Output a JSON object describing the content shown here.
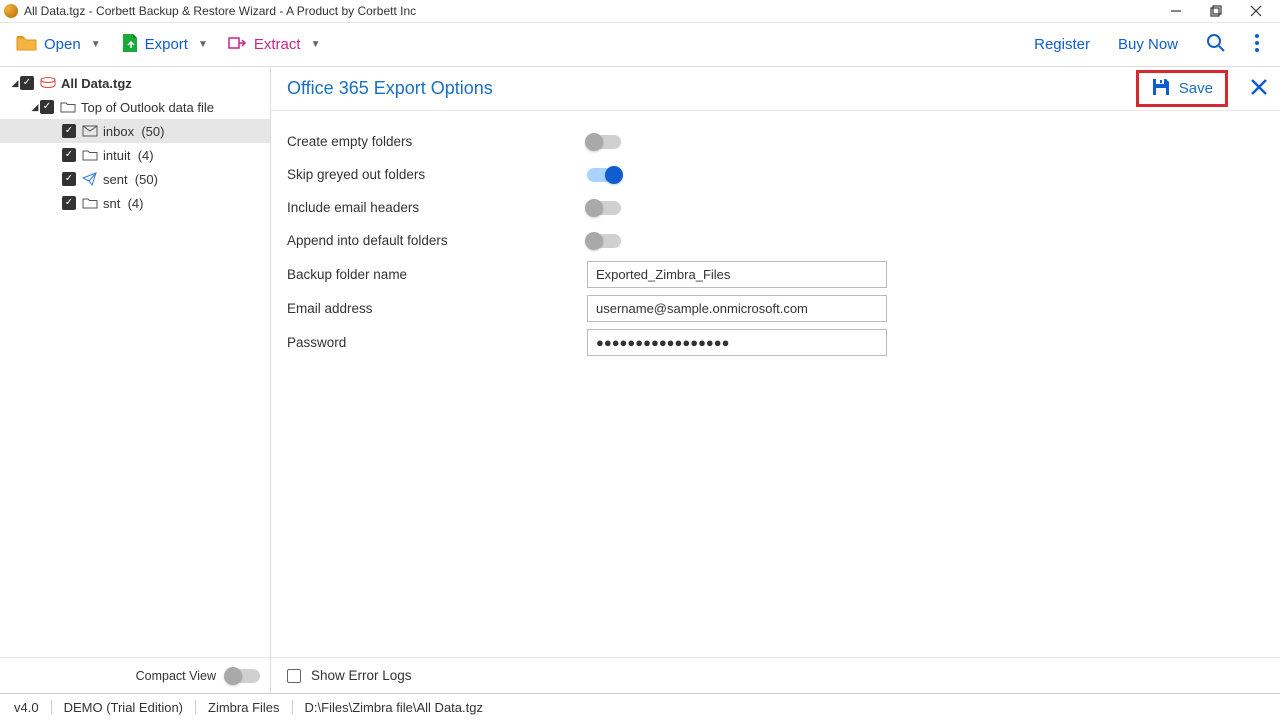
{
  "titlebar": {
    "text": "All Data.tgz - Corbett Backup & Restore Wizard - A Product by Corbett Inc"
  },
  "toolbar": {
    "open": "Open",
    "export": "Export",
    "extract": "Extract",
    "register": "Register",
    "buy_now": "Buy Now"
  },
  "tree": {
    "root": {
      "label": "All Data.tgz"
    },
    "top": {
      "label": "Top of Outlook data file"
    },
    "items": [
      {
        "label": "inbox",
        "count": "(50)",
        "selected": true,
        "icon": "mail"
      },
      {
        "label": "intuit",
        "count": "(4)",
        "selected": false,
        "icon": "folder"
      },
      {
        "label": "sent",
        "count": "(50)",
        "selected": false,
        "icon": "sent"
      },
      {
        "label": "snt",
        "count": "(4)",
        "selected": false,
        "icon": "folder"
      }
    ]
  },
  "sidebar_footer": {
    "label": "Compact View"
  },
  "panel": {
    "title": "Office 365 Export Options",
    "save": "Save",
    "opts": [
      {
        "label": "Create empty folders",
        "on": false
      },
      {
        "label": "Skip greyed out folders",
        "on": true
      },
      {
        "label": "Include email headers",
        "on": false
      },
      {
        "label": "Append into default folders",
        "on": false
      }
    ],
    "backup_label": "Backup folder name",
    "backup_value": "Exported_Zimbra_Files",
    "email_label": "Email address",
    "email_value": "username@sample.onmicrosoft.com",
    "pwd_label": "Password",
    "pwd_value": "●●●●●●●●●●●●●●●●●",
    "footer": "Show Error Logs"
  },
  "status": {
    "version": "v4.0",
    "edition": "DEMO (Trial Edition)",
    "mode": "Zimbra Files",
    "path": "D:\\Files\\Zimbra file\\All Data.tgz"
  }
}
